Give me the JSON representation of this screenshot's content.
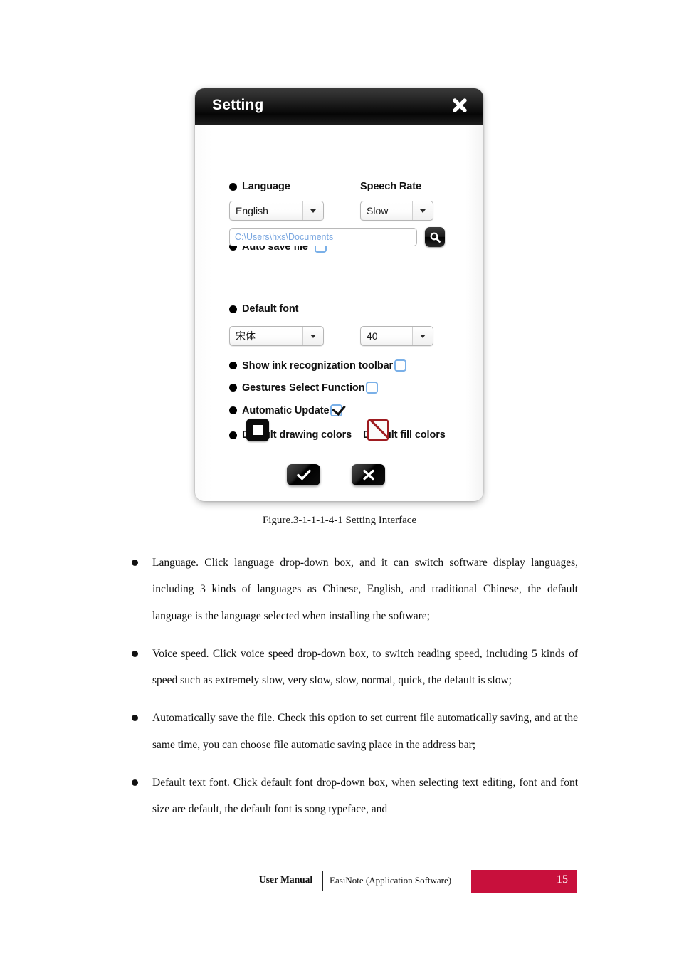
{
  "dialog": {
    "title": "Setting",
    "close_icon": "close-icon",
    "language": {
      "label": "Language",
      "value": "English"
    },
    "speech_rate": {
      "label": "Speech Rate",
      "value": "Slow"
    },
    "auto_save": {
      "label": "Auto save file",
      "checked": false,
      "path_value": "C:\\Users\\hxs\\Documents",
      "browse_icon": "search-icon"
    },
    "default_font": {
      "label": "Default font",
      "family_value": "宋体",
      "size_value": "40"
    },
    "ink_toolbar": {
      "label": "Show ink recognization toolbar",
      "checked": false
    },
    "gestures": {
      "label": "Gestures Select Function",
      "checked": false
    },
    "auto_update": {
      "label": "Automatic Update",
      "checked": true
    },
    "drawing_colors": {
      "label": "Default drawing colors",
      "swatch_color": "#0b0b0b",
      "inner_color": "#ffffff"
    },
    "fill_colors": {
      "label": "Default fill colors",
      "swatch_color": "#9e1b20",
      "inner_color": "#fbfbfb"
    },
    "confirm_icon": "check-icon",
    "cancel_icon": "x-icon"
  },
  "document": {
    "figure_caption": "Figure.3-1-1-1-4-1 Setting Interface",
    "bullets": [
      "Language. Click language drop-down box, and it can switch software display languages, including 3 kinds of languages as Chinese, English, and traditional Chinese, the default language is the language selected when installing the software;",
      "Voice speed. Click voice speed drop-down box, to switch reading speed, including 5 kinds of speed such as extremely slow, very slow, slow, normal, quick, the default is slow;",
      "Automatically save the file. Check this option to set current file automatically saving, and at the same time, you can choose file automatic saving place in the address bar;",
      "Default text font. Click default font drop-down box, when selecting text editing, font and font size are default, the default font is song typeface, and"
    ]
  },
  "footer": {
    "title": "User Manual",
    "subtitle": "EasiNote (Application Software)",
    "page_number": "15",
    "bar_color": "#C8103C"
  }
}
